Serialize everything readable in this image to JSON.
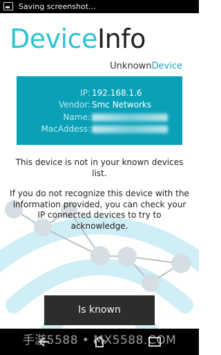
{
  "status_bar": {
    "text": "Saving screenshot…"
  },
  "app": {
    "title_part1": "Device",
    "title_part2": "Info"
  },
  "device": {
    "name_part1": "Unknown",
    "name_part2": "Device"
  },
  "info": {
    "rows": [
      {
        "label": "IP:",
        "value": "192.168.1.6"
      },
      {
        "label": "Vendor:",
        "value": "Smc Networks"
      },
      {
        "label": "Name:",
        "value": ""
      },
      {
        "label": "MacAddess:",
        "value": ""
      }
    ]
  },
  "messages": {
    "not_known": "This device is not in your known devices list.",
    "instructions": "If you do not recognize this device with the information provided, you can check your IP connected devices to try to acknowledge."
  },
  "actions": {
    "known_label": "Is known"
  },
  "watermark": "手游5588 • MX5588.COM",
  "colors": {
    "accent": "#2cc3d2",
    "card": "#0aa0b8",
    "button": "#2d2d2d"
  }
}
